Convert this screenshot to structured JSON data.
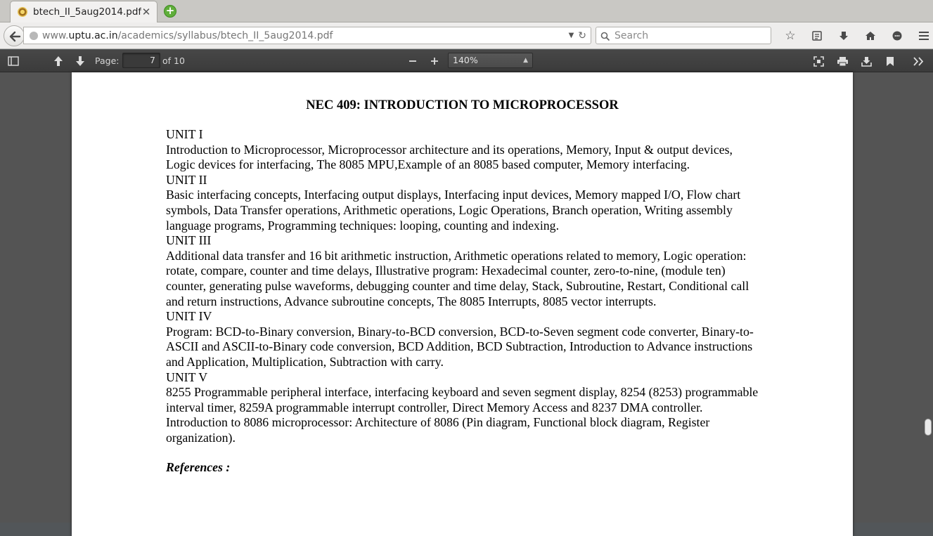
{
  "browser": {
    "tab_title": "btech_II_5aug2014.pdf",
    "url_prefix": "www.",
    "url_domain": "uptu.ac.in",
    "url_path": "/academics/syllabus/btech_II_5aug2014.pdf",
    "search_placeholder": "Search"
  },
  "pdf_toolbar": {
    "page_label": "Page:",
    "page_number": "7",
    "page_total": "of 10",
    "zoom": "140%"
  },
  "document": {
    "title": "NEC 409: INTRODUCTION TO MICROPROCESSOR",
    "units": [
      {
        "heading": "UNIT I",
        "text": "Introduction to Microprocessor, Microprocessor architecture and its operations, Memory, Input & output devices, Logic devices for interfacing, The 8085 MPU,Example of an 8085 based computer, Memory interfacing."
      },
      {
        "heading": "UNIT II",
        "text": "Basic interfacing concepts, Interfacing output displays, Interfacing input devices, Memory mapped I/O, Flow chart symbols, Data Transfer operations, Arithmetic operations, Logic Operations, Branch operation, Writing assembly language programs, Programming techniques: looping, counting and indexing."
      },
      {
        "heading": "UNIT III",
        "text": "Additional data transfer and 16 bit arithmetic instruction, Arithmetic operations related to memory, Logic operation: rotate, compare, counter and time delays, Illustrative program: Hexadecimal counter, zero-to-nine, (module ten) counter, generating pulse waveforms, debugging counter and time delay, Stack, Subroutine, Restart, Conditional call and return instructions, Advance subroutine concepts, The 8085 Interrupts, 8085 vector interrupts."
      },
      {
        "heading": "UNIT IV",
        "text": "Program: BCD-to-Binary conversion, Binary-to-BCD conversion, BCD-to-Seven segment code converter, Binary-to-ASCII and ASCII-to-Binary code conversion, BCD Addition, BCD Subtraction, Introduction to Advance instructions and Application, Multiplication, Subtraction with carry."
      },
      {
        "heading": "UNIT V",
        "text": "8255 Programmable peripheral interface, interfacing keyboard and seven segment display, 8254 (8253) programmable interval timer, 8259A programmable interrupt controller, Direct Memory Access and 8237 DMA controller."
      }
    ],
    "extra_paragraph": "Introduction to 8086 microprocessor: Architecture of 8086 (Pin diagram, Functional block diagram, Register organization).",
    "references_heading": "References :"
  }
}
